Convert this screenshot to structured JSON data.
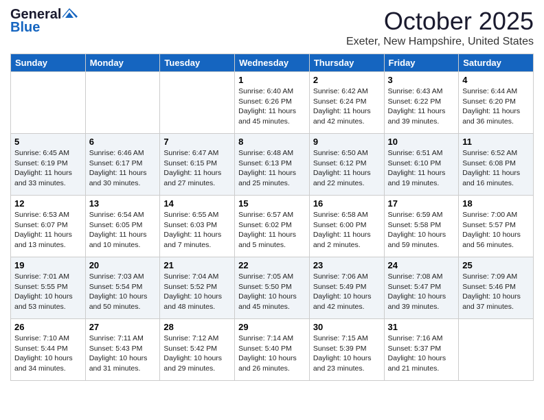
{
  "header": {
    "logo_general": "General",
    "logo_blue": "Blue",
    "month": "October 2025",
    "location": "Exeter, New Hampshire, United States"
  },
  "days_of_week": [
    "Sunday",
    "Monday",
    "Tuesday",
    "Wednesday",
    "Thursday",
    "Friday",
    "Saturday"
  ],
  "weeks": [
    [
      {
        "day": "",
        "info": ""
      },
      {
        "day": "",
        "info": ""
      },
      {
        "day": "",
        "info": ""
      },
      {
        "day": "1",
        "info": "Sunrise: 6:40 AM\nSunset: 6:26 PM\nDaylight: 11 hours\nand 45 minutes."
      },
      {
        "day": "2",
        "info": "Sunrise: 6:42 AM\nSunset: 6:24 PM\nDaylight: 11 hours\nand 42 minutes."
      },
      {
        "day": "3",
        "info": "Sunrise: 6:43 AM\nSunset: 6:22 PM\nDaylight: 11 hours\nand 39 minutes."
      },
      {
        "day": "4",
        "info": "Sunrise: 6:44 AM\nSunset: 6:20 PM\nDaylight: 11 hours\nand 36 minutes."
      }
    ],
    [
      {
        "day": "5",
        "info": "Sunrise: 6:45 AM\nSunset: 6:19 PM\nDaylight: 11 hours\nand 33 minutes."
      },
      {
        "day": "6",
        "info": "Sunrise: 6:46 AM\nSunset: 6:17 PM\nDaylight: 11 hours\nand 30 minutes."
      },
      {
        "day": "7",
        "info": "Sunrise: 6:47 AM\nSunset: 6:15 PM\nDaylight: 11 hours\nand 27 minutes."
      },
      {
        "day": "8",
        "info": "Sunrise: 6:48 AM\nSunset: 6:13 PM\nDaylight: 11 hours\nand 25 minutes."
      },
      {
        "day": "9",
        "info": "Sunrise: 6:50 AM\nSunset: 6:12 PM\nDaylight: 11 hours\nand 22 minutes."
      },
      {
        "day": "10",
        "info": "Sunrise: 6:51 AM\nSunset: 6:10 PM\nDaylight: 11 hours\nand 19 minutes."
      },
      {
        "day": "11",
        "info": "Sunrise: 6:52 AM\nSunset: 6:08 PM\nDaylight: 11 hours\nand 16 minutes."
      }
    ],
    [
      {
        "day": "12",
        "info": "Sunrise: 6:53 AM\nSunset: 6:07 PM\nDaylight: 11 hours\nand 13 minutes."
      },
      {
        "day": "13",
        "info": "Sunrise: 6:54 AM\nSunset: 6:05 PM\nDaylight: 11 hours\nand 10 minutes."
      },
      {
        "day": "14",
        "info": "Sunrise: 6:55 AM\nSunset: 6:03 PM\nDaylight: 11 hours\nand 7 minutes."
      },
      {
        "day": "15",
        "info": "Sunrise: 6:57 AM\nSunset: 6:02 PM\nDaylight: 11 hours\nand 5 minutes."
      },
      {
        "day": "16",
        "info": "Sunrise: 6:58 AM\nSunset: 6:00 PM\nDaylight: 11 hours\nand 2 minutes."
      },
      {
        "day": "17",
        "info": "Sunrise: 6:59 AM\nSunset: 5:58 PM\nDaylight: 10 hours\nand 59 minutes."
      },
      {
        "day": "18",
        "info": "Sunrise: 7:00 AM\nSunset: 5:57 PM\nDaylight: 10 hours\nand 56 minutes."
      }
    ],
    [
      {
        "day": "19",
        "info": "Sunrise: 7:01 AM\nSunset: 5:55 PM\nDaylight: 10 hours\nand 53 minutes."
      },
      {
        "day": "20",
        "info": "Sunrise: 7:03 AM\nSunset: 5:54 PM\nDaylight: 10 hours\nand 50 minutes."
      },
      {
        "day": "21",
        "info": "Sunrise: 7:04 AM\nSunset: 5:52 PM\nDaylight: 10 hours\nand 48 minutes."
      },
      {
        "day": "22",
        "info": "Sunrise: 7:05 AM\nSunset: 5:50 PM\nDaylight: 10 hours\nand 45 minutes."
      },
      {
        "day": "23",
        "info": "Sunrise: 7:06 AM\nSunset: 5:49 PM\nDaylight: 10 hours\nand 42 minutes."
      },
      {
        "day": "24",
        "info": "Sunrise: 7:08 AM\nSunset: 5:47 PM\nDaylight: 10 hours\nand 39 minutes."
      },
      {
        "day": "25",
        "info": "Sunrise: 7:09 AM\nSunset: 5:46 PM\nDaylight: 10 hours\nand 37 minutes."
      }
    ],
    [
      {
        "day": "26",
        "info": "Sunrise: 7:10 AM\nSunset: 5:44 PM\nDaylight: 10 hours\nand 34 minutes."
      },
      {
        "day": "27",
        "info": "Sunrise: 7:11 AM\nSunset: 5:43 PM\nDaylight: 10 hours\nand 31 minutes."
      },
      {
        "day": "28",
        "info": "Sunrise: 7:12 AM\nSunset: 5:42 PM\nDaylight: 10 hours\nand 29 minutes."
      },
      {
        "day": "29",
        "info": "Sunrise: 7:14 AM\nSunset: 5:40 PM\nDaylight: 10 hours\nand 26 minutes."
      },
      {
        "day": "30",
        "info": "Sunrise: 7:15 AM\nSunset: 5:39 PM\nDaylight: 10 hours\nand 23 minutes."
      },
      {
        "day": "31",
        "info": "Sunrise: 7:16 AM\nSunset: 5:37 PM\nDaylight: 10 hours\nand 21 minutes."
      },
      {
        "day": "",
        "info": ""
      }
    ]
  ]
}
